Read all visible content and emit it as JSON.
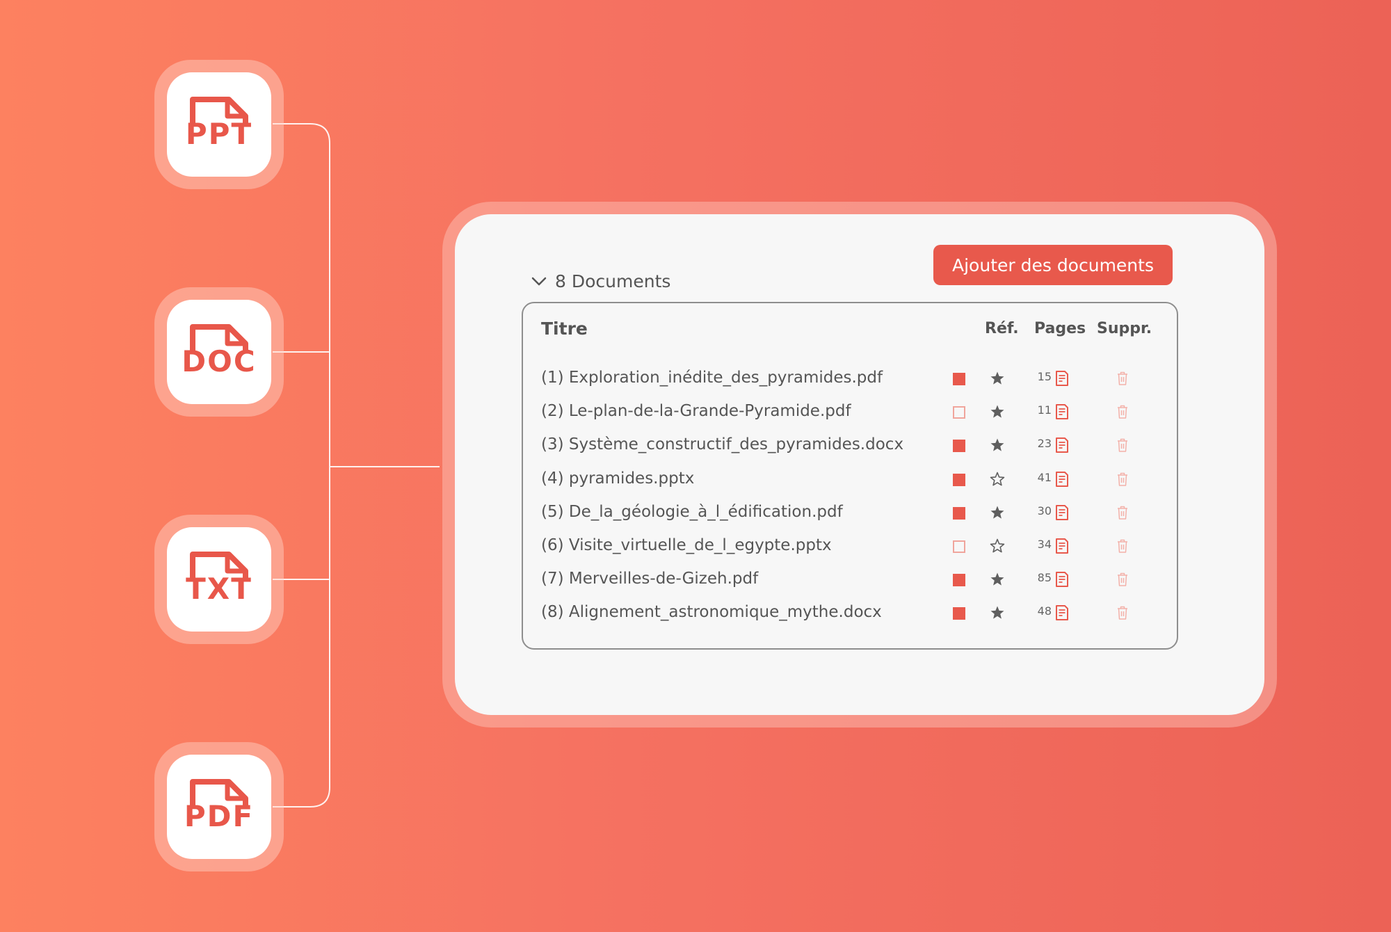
{
  "file_types": [
    {
      "label": "PPT",
      "icon": "file-icon"
    },
    {
      "label": "DOC",
      "icon": "file-icon"
    },
    {
      "label": "TXT",
      "icon": "file-icon"
    },
    {
      "label": "PDF",
      "icon": "file-icon"
    }
  ],
  "panel": {
    "add_button_label": "Ajouter des documents",
    "documents_toggle_label": "8 Documents",
    "columns": {
      "title": "Titre",
      "ref": "Réf.",
      "pages": "Pages",
      "delete": "Suppr."
    },
    "rows": [
      {
        "title": "(1) Exploration_inédite_des_pyramides.pdf",
        "selected": true,
        "starred": true,
        "pages": "15"
      },
      {
        "title": "(2) Le-plan-de-la-Grande-Pyramide.pdf",
        "selected": false,
        "starred": true,
        "pages": "11"
      },
      {
        "title": "(3) Système_constructif_des_pyramides.docx",
        "selected": true,
        "starred": true,
        "pages": "23"
      },
      {
        "title": "(4) pyramides.pptx",
        "selected": true,
        "starred": false,
        "pages": "41"
      },
      {
        "title": "(5) De_la_géologie_à_l_édification.pdf",
        "selected": true,
        "starred": true,
        "pages": "30"
      },
      {
        "title": "(6) Visite_virtuelle_de_l_egypte.pptx",
        "selected": false,
        "starred": false,
        "pages": "34"
      },
      {
        "title": "(7) Merveilles-de-Gizeh.pdf",
        "selected": true,
        "starred": true,
        "pages": "85"
      },
      {
        "title": "(8) Alignement_astronomique_mythe.docx",
        "selected": true,
        "starred": true,
        "pages": "48"
      }
    ]
  },
  "colors": {
    "accent": "#e8594c",
    "background_start": "#fd8160",
    "background_end": "#ec6256",
    "panel": "#f7f7f7"
  }
}
